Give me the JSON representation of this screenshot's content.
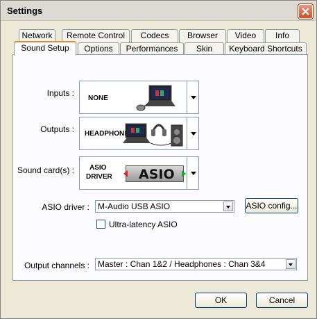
{
  "window": {
    "title": "Settings"
  },
  "tabs_row1": [
    {
      "label": "Network"
    },
    {
      "label": "Remote Control"
    },
    {
      "label": "Codecs"
    },
    {
      "label": "Browser"
    },
    {
      "label": "Video"
    },
    {
      "label": "Info"
    }
  ],
  "tabs_row2": [
    {
      "label": "Sound Setup"
    },
    {
      "label": "Options"
    },
    {
      "label": "Performances"
    },
    {
      "label": "Skin"
    },
    {
      "label": "Keyboard Shortcuts"
    }
  ],
  "inputs": {
    "label": "Inputs :",
    "value": "NONE"
  },
  "outputs": {
    "label": "Outputs :",
    "value": "HEADPHONES"
  },
  "sound_card": {
    "label": "Sound card(s) :",
    "value_line1": "ASIO",
    "value_line2": "DRIVER",
    "logo_text": "ASIO"
  },
  "asio_driver": {
    "label": "ASIO driver :",
    "value": "M-Audio USB ASIO",
    "config_button": "ASIO config..."
  },
  "ultra_latency": {
    "label": "Ultra-latency ASIO",
    "checked": false
  },
  "output_channels": {
    "label": "Output channels :",
    "value": "Master : Chan 1&2 / Headphones : Chan 3&4"
  },
  "footer": {
    "ok": "OK",
    "cancel": "Cancel"
  }
}
